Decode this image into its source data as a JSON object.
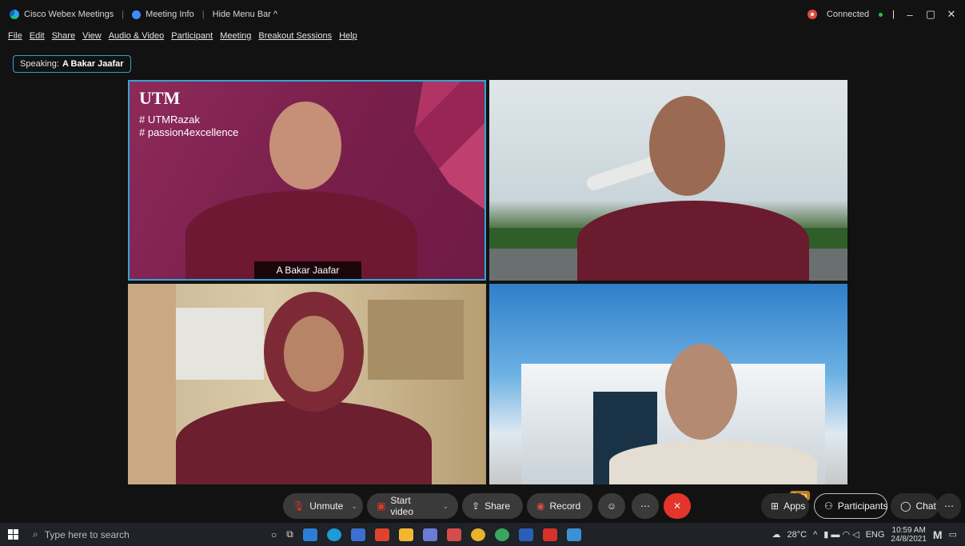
{
  "titlebar": {
    "app_title": "Cisco Webex Meetings",
    "meeting_info": "Meeting Info",
    "hide_menu": "Hide Menu Bar ^",
    "status": "Connected"
  },
  "menu": [
    "File",
    "Edit",
    "Share",
    "View",
    "Audio & Video",
    "Participant",
    "Meeting",
    "Breakout Sessions",
    "Help"
  ],
  "speaking": {
    "label": "Speaking:",
    "name": "A Bakar Jaafar"
  },
  "tiles": {
    "t1": {
      "name": "A Bakar Jaafar",
      "logo": "UTM",
      "hashtag1": "# UTMRazak",
      "hashtag2": "# passion4excellence"
    }
  },
  "toolbar": {
    "unmute": "Unmute",
    "start_video": "Start video",
    "share": "Share",
    "record": "Record",
    "apps": "Apps",
    "apps_badge": "Beta",
    "participants": "Participants",
    "chat": "Chat"
  },
  "taskbar": {
    "search_placeholder": "Type here to search",
    "weather": "28°C",
    "lang": "ENG",
    "time": "10:59 AM",
    "date": "24/8/2021"
  },
  "colors": {
    "active_speaker": "#2ea6d8",
    "end_call": "#e3352c",
    "bg": "#121212"
  }
}
